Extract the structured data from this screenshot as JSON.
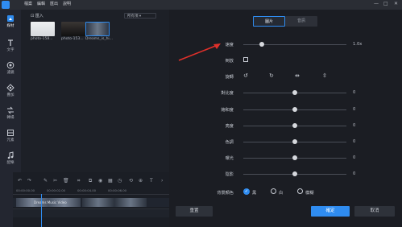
{
  "topbar": {
    "menu": [
      "檔案",
      "編輯",
      "匯出",
      "說明"
    ],
    "window_buttons": [
      "—",
      "□",
      "✕"
    ]
  },
  "leftbar": {
    "items": [
      {
        "label": "媒材",
        "icon": "media-icon"
      },
      {
        "label": "文字",
        "icon": "text-icon"
      },
      {
        "label": "濾鏡",
        "icon": "filter-icon"
      },
      {
        "label": "疊加",
        "icon": "overlay-icon"
      },
      {
        "label": "轉場",
        "icon": "transition-icon"
      },
      {
        "label": "元素",
        "icon": "element-icon"
      },
      {
        "label": "配樂",
        "icon": "music-icon"
      }
    ]
  },
  "media": {
    "import_label": "匯入",
    "filter_value": "所有項",
    "thumbs": [
      {
        "label": "photo-158..."
      },
      {
        "label": "photo-153..."
      },
      {
        "label": "Dreams_is_hi..."
      }
    ]
  },
  "timeline": {
    "ticks": [
      "00:00:00.00",
      "00:00:02.00",
      "00:00:04.00",
      "00:00:06.00"
    ],
    "clip_label": "Dreams Music Video"
  },
  "panel": {
    "tabs": {
      "active": "圖片",
      "inactive": "音訊"
    },
    "speed_label": "速度",
    "speed_value": "1.0x",
    "reverse_label": "倒放",
    "rotate_label": "旋轉",
    "sliders": [
      {
        "label": "對比度",
        "value": "0"
      },
      {
        "label": "飽和度",
        "value": "0"
      },
      {
        "label": "亮度",
        "value": "0"
      },
      {
        "label": "色調",
        "value": "0"
      },
      {
        "label": "曝光",
        "value": "0"
      },
      {
        "label": "陰影",
        "value": "0"
      }
    ],
    "bg_color_label": "背景顏色",
    "bg_options": [
      "黑",
      "白",
      "模糊"
    ],
    "reset_label": "重置",
    "ok_label": "確定",
    "cancel_label": "取消"
  },
  "colors": {
    "accent": "#2f8cf0",
    "arrow": "#e0302a"
  }
}
